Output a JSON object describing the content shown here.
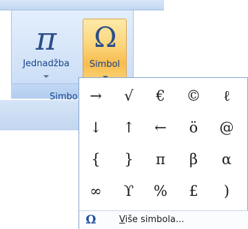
{
  "ribbon": {
    "group_label": "Simbo",
    "equation_button": {
      "glyph": "π",
      "label": "Jednadžba"
    },
    "symbol_button": {
      "glyph": "Ω",
      "label": "Simbol"
    }
  },
  "symbol_gallery": {
    "rows": [
      [
        "→",
        "√",
        "€",
        "©",
        "ℓ"
      ],
      [
        "↓",
        "↑",
        "←",
        "ö",
        "@"
      ],
      [
        "{",
        "}",
        "π",
        "β",
        "α"
      ],
      [
        "∞",
        "ϒ",
        "%",
        "£",
        ")"
      ]
    ],
    "more_icon": "Ω",
    "more_label_access_key": "V",
    "more_label_rest": "iše simbola..."
  }
}
